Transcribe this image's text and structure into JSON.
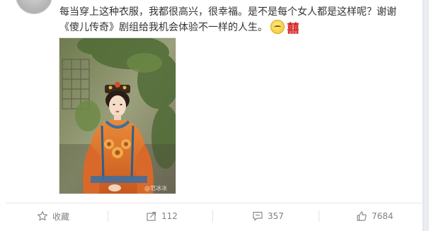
{
  "post": {
    "text_line1": "每当穿上这种衣服，我都很高兴，很幸福。是不是每个女人都是这样呢？谢谢",
    "text_line2": "《傻儿传奇》剧组给我机会体验不一样的人生。",
    "emoji_xi": "囍",
    "image_watermark": "@范冰冰"
  },
  "actions": {
    "favorite_label": "收藏",
    "repost_count": "112",
    "comment_count": "357",
    "like_count": "7684"
  },
  "icons": {
    "favorite": "star-icon",
    "repost": "share-icon",
    "comment": "comment-icon",
    "like": "thumbs-up-icon"
  },
  "colors": {
    "text": "#333333",
    "muted": "#808080",
    "background": "#e9edf2",
    "card": "#ffffff"
  }
}
